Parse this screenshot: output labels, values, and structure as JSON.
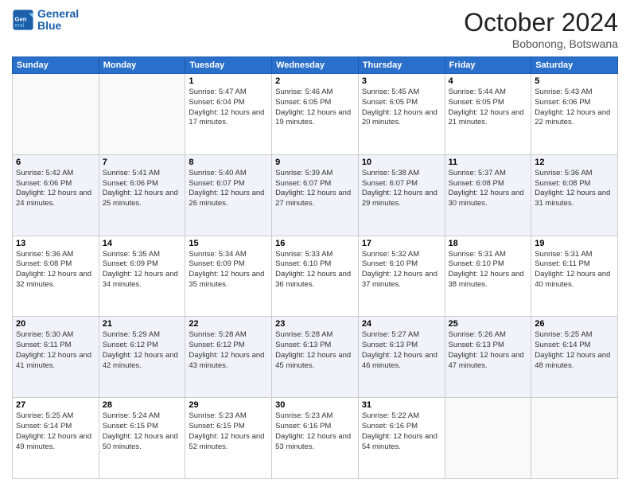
{
  "header": {
    "logo_line1": "General",
    "logo_line2": "Blue",
    "month": "October 2024",
    "location": "Bobonong, Botswana"
  },
  "weekdays": [
    "Sunday",
    "Monday",
    "Tuesday",
    "Wednesday",
    "Thursday",
    "Friday",
    "Saturday"
  ],
  "weeks": [
    [
      {
        "day": "",
        "info": ""
      },
      {
        "day": "",
        "info": ""
      },
      {
        "day": "1",
        "info": "Sunrise: 5:47 AM\nSunset: 6:04 PM\nDaylight: 12 hours and 17 minutes."
      },
      {
        "day": "2",
        "info": "Sunrise: 5:46 AM\nSunset: 6:05 PM\nDaylight: 12 hours and 19 minutes."
      },
      {
        "day": "3",
        "info": "Sunrise: 5:45 AM\nSunset: 6:05 PM\nDaylight: 12 hours and 20 minutes."
      },
      {
        "day": "4",
        "info": "Sunrise: 5:44 AM\nSunset: 6:05 PM\nDaylight: 12 hours and 21 minutes."
      },
      {
        "day": "5",
        "info": "Sunrise: 5:43 AM\nSunset: 6:06 PM\nDaylight: 12 hours and 22 minutes."
      }
    ],
    [
      {
        "day": "6",
        "info": "Sunrise: 5:42 AM\nSunset: 6:06 PM\nDaylight: 12 hours and 24 minutes."
      },
      {
        "day": "7",
        "info": "Sunrise: 5:41 AM\nSunset: 6:06 PM\nDaylight: 12 hours and 25 minutes."
      },
      {
        "day": "8",
        "info": "Sunrise: 5:40 AM\nSunset: 6:07 PM\nDaylight: 12 hours and 26 minutes."
      },
      {
        "day": "9",
        "info": "Sunrise: 5:39 AM\nSunset: 6:07 PM\nDaylight: 12 hours and 27 minutes."
      },
      {
        "day": "10",
        "info": "Sunrise: 5:38 AM\nSunset: 6:07 PM\nDaylight: 12 hours and 29 minutes."
      },
      {
        "day": "11",
        "info": "Sunrise: 5:37 AM\nSunset: 6:08 PM\nDaylight: 12 hours and 30 minutes."
      },
      {
        "day": "12",
        "info": "Sunrise: 5:36 AM\nSunset: 6:08 PM\nDaylight: 12 hours and 31 minutes."
      }
    ],
    [
      {
        "day": "13",
        "info": "Sunrise: 5:36 AM\nSunset: 6:08 PM\nDaylight: 12 hours and 32 minutes."
      },
      {
        "day": "14",
        "info": "Sunrise: 5:35 AM\nSunset: 6:09 PM\nDaylight: 12 hours and 34 minutes."
      },
      {
        "day": "15",
        "info": "Sunrise: 5:34 AM\nSunset: 6:09 PM\nDaylight: 12 hours and 35 minutes."
      },
      {
        "day": "16",
        "info": "Sunrise: 5:33 AM\nSunset: 6:10 PM\nDaylight: 12 hours and 36 minutes."
      },
      {
        "day": "17",
        "info": "Sunrise: 5:32 AM\nSunset: 6:10 PM\nDaylight: 12 hours and 37 minutes."
      },
      {
        "day": "18",
        "info": "Sunrise: 5:31 AM\nSunset: 6:10 PM\nDaylight: 12 hours and 38 minutes."
      },
      {
        "day": "19",
        "info": "Sunrise: 5:31 AM\nSunset: 6:11 PM\nDaylight: 12 hours and 40 minutes."
      }
    ],
    [
      {
        "day": "20",
        "info": "Sunrise: 5:30 AM\nSunset: 6:11 PM\nDaylight: 12 hours and 41 minutes."
      },
      {
        "day": "21",
        "info": "Sunrise: 5:29 AM\nSunset: 6:12 PM\nDaylight: 12 hours and 42 minutes."
      },
      {
        "day": "22",
        "info": "Sunrise: 5:28 AM\nSunset: 6:12 PM\nDaylight: 12 hours and 43 minutes."
      },
      {
        "day": "23",
        "info": "Sunrise: 5:28 AM\nSunset: 6:13 PM\nDaylight: 12 hours and 45 minutes."
      },
      {
        "day": "24",
        "info": "Sunrise: 5:27 AM\nSunset: 6:13 PM\nDaylight: 12 hours and 46 minutes."
      },
      {
        "day": "25",
        "info": "Sunrise: 5:26 AM\nSunset: 6:13 PM\nDaylight: 12 hours and 47 minutes."
      },
      {
        "day": "26",
        "info": "Sunrise: 5:25 AM\nSunset: 6:14 PM\nDaylight: 12 hours and 48 minutes."
      }
    ],
    [
      {
        "day": "27",
        "info": "Sunrise: 5:25 AM\nSunset: 6:14 PM\nDaylight: 12 hours and 49 minutes."
      },
      {
        "day": "28",
        "info": "Sunrise: 5:24 AM\nSunset: 6:15 PM\nDaylight: 12 hours and 50 minutes."
      },
      {
        "day": "29",
        "info": "Sunrise: 5:23 AM\nSunset: 6:15 PM\nDaylight: 12 hours and 52 minutes."
      },
      {
        "day": "30",
        "info": "Sunrise: 5:23 AM\nSunset: 6:16 PM\nDaylight: 12 hours and 53 minutes."
      },
      {
        "day": "31",
        "info": "Sunrise: 5:22 AM\nSunset: 6:16 PM\nDaylight: 12 hours and 54 minutes."
      },
      {
        "day": "",
        "info": ""
      },
      {
        "day": "",
        "info": ""
      }
    ]
  ]
}
